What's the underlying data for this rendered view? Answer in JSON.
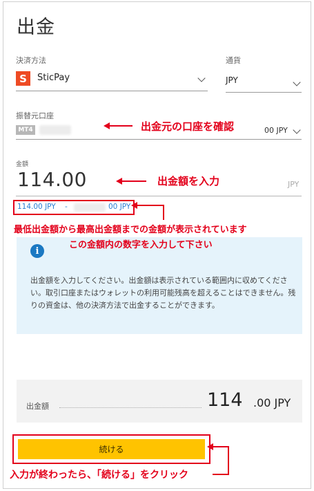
{
  "page": {
    "title": "出金"
  },
  "payment": {
    "label": "決済方法",
    "logo_letter": "S",
    "method": "SticPay"
  },
  "currency": {
    "label": "通貨",
    "value": "JPY"
  },
  "account": {
    "label": "振替元口座",
    "badge": "MT4",
    "balance_tail": "00 JPY"
  },
  "amount": {
    "label": "金額",
    "value": "114.00",
    "unit": "JPY"
  },
  "range": {
    "min": "114.00 JPY",
    "dash": "-",
    "max_tail": "00 JPY"
  },
  "info": {
    "icon": "i",
    "text": "出金額を入力してください。出金額は表示されている範囲内に収めてください。取引口座またはウォレットの利用可能残高を超えることはできません。残りの資金は、他の決済方法で出金することができます。"
  },
  "summary": {
    "label": "出金額",
    "amount_int": "114",
    "amount_rest": ".00 JPY"
  },
  "button": {
    "continue_label": "続ける"
  },
  "annotations": {
    "account_check": "出金元の口座を確認",
    "amount_enter": "出金額を入力",
    "range_line1": "最低出金額から最高出金額までの金額が表示されています",
    "range_line2": "この金額内の数字を入力して下さい",
    "continue_click": "入力が終わったら、「続ける」をクリック"
  },
  "colors": {
    "accent_red": "#e3001b",
    "button_yellow": "#ffc300",
    "link_blue": "#2a7fd4",
    "info_bg": "#e5f3fb",
    "sticpay_orange": "#ee4b24"
  }
}
